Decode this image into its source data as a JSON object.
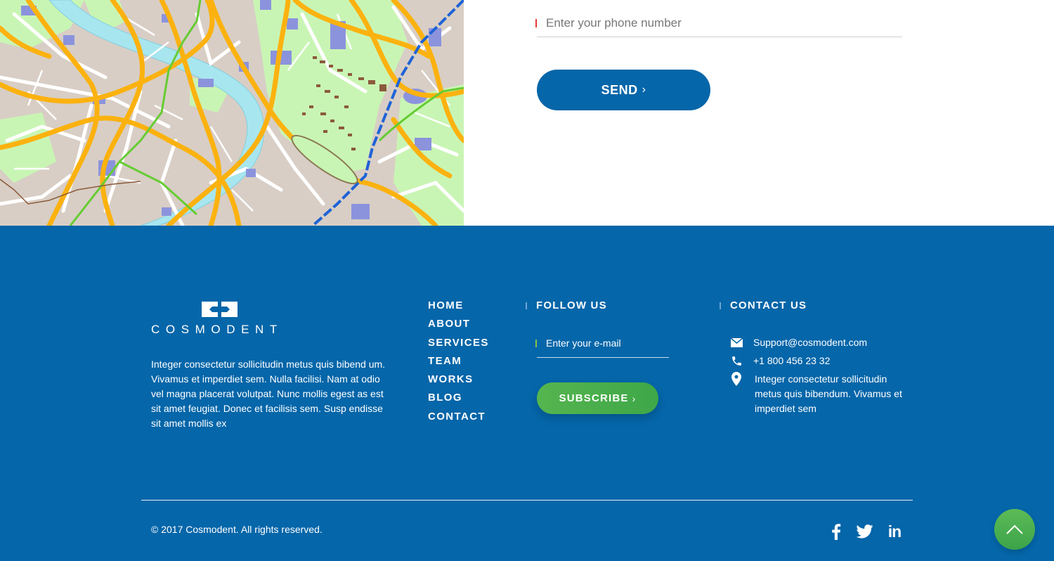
{
  "contact_form": {
    "phone_placeholder": "Enter your phone number",
    "send_label": "SEND",
    "send_chevron": "›"
  },
  "footer": {
    "logo_text": "COSMODENT",
    "about": "Integer consectetur sollicitudin metus quis bibend um. Vivamus et imperdiet sem. Nulla facilisi. Nam at odio vel magna placerat volutpat. Nunc mollis egest as est sit amet feugiat. Donec et facilisis sem. Susp endisse sit amet mollis ex",
    "nav": [
      "HOME",
      "ABOUT",
      "SERVICES",
      "TEAM",
      "WORKS",
      "BLOG",
      "CONTACT"
    ],
    "follow": {
      "heading": "FOLLOW US",
      "email_placeholder": "Enter your e-mail",
      "subscribe_label": "SUBSCRIBE",
      "subscribe_chevron": "›"
    },
    "contact": {
      "heading": "CONTACT US",
      "email": "Support@cosmodent.com",
      "phone": "+1 800 456 23 32",
      "address": "Integer consectetur sollicitudin metus quis bibendum. Vivamus et imperdiet sem"
    },
    "copyright": "© 2017 Cosmodent. All rights reserved.",
    "social": {
      "facebook_icon": "facebook-icon",
      "twitter_icon": "twitter-icon",
      "linkedin_text": "in"
    }
  },
  "colors": {
    "primary": "#0566a9",
    "accent_green": "#4caf50",
    "white": "#ffffff"
  }
}
